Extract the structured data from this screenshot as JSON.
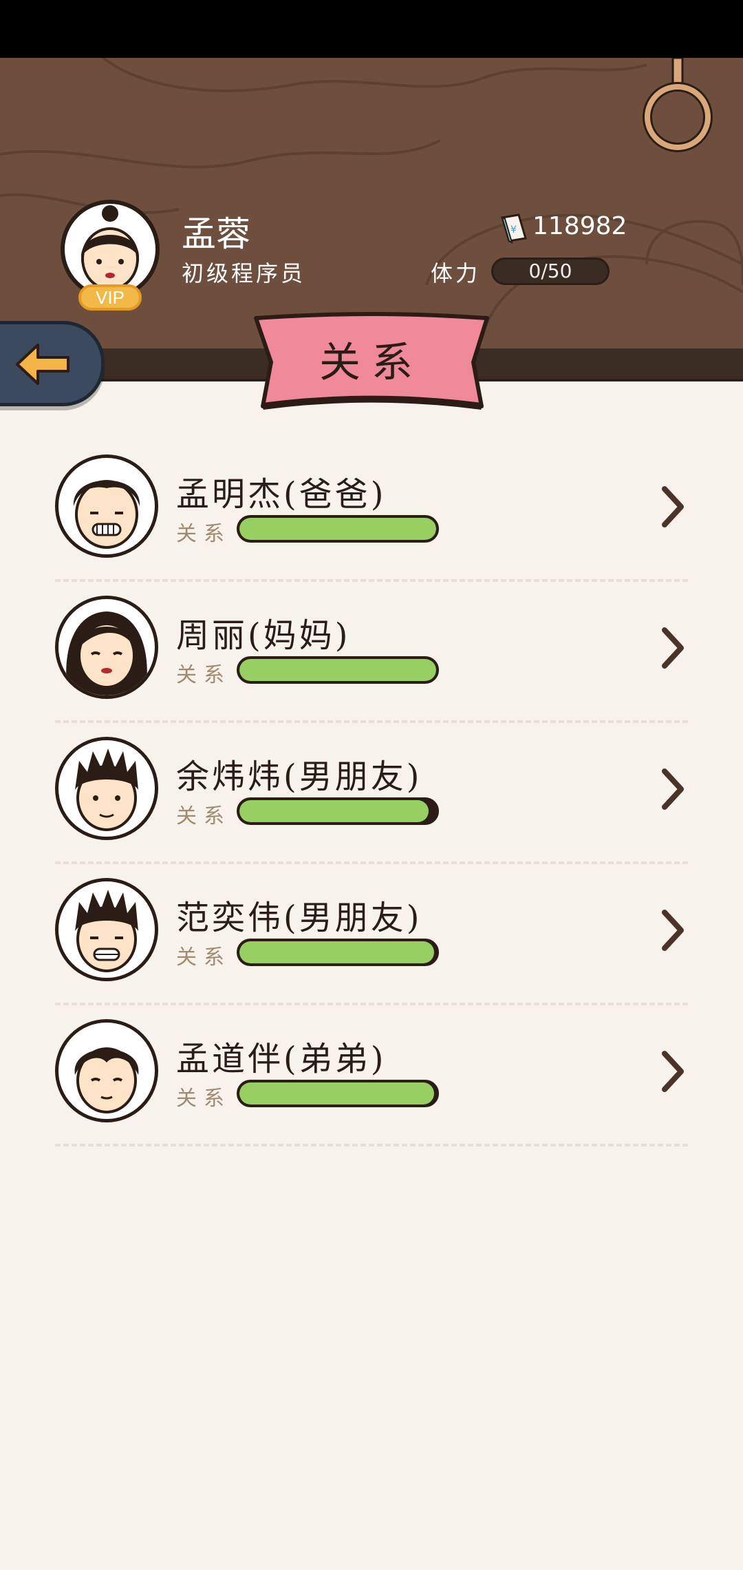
{
  "header": {
    "user_name": "孟蓉",
    "user_title": "初级程序员",
    "vip_label": "VIP",
    "money": "118982",
    "stamina_label": "体力",
    "stamina_value": "0/50"
  },
  "page_title": "关系",
  "relation_label": "关系",
  "relations": [
    {
      "name": "孟明杰(爸爸)",
      "level": 1.0
    },
    {
      "name": "周丽(妈妈)",
      "level": 1.0
    },
    {
      "name": "余炜炜(男朋友)",
      "level": 0.96
    },
    {
      "name": "范奕伟(男朋友)",
      "level": 0.99
    },
    {
      "name": "孟道伴(弟弟)",
      "level": 0.99
    }
  ],
  "icons": {
    "back": "arrow-left-icon",
    "money": "money-icon",
    "chevron": "chevron-right-icon"
  },
  "colors": {
    "header_bg": "#6e4f3d",
    "ribbon": "#f08a9a",
    "bar_fill": "#98cf63",
    "back_button": "#3b4a5e"
  }
}
